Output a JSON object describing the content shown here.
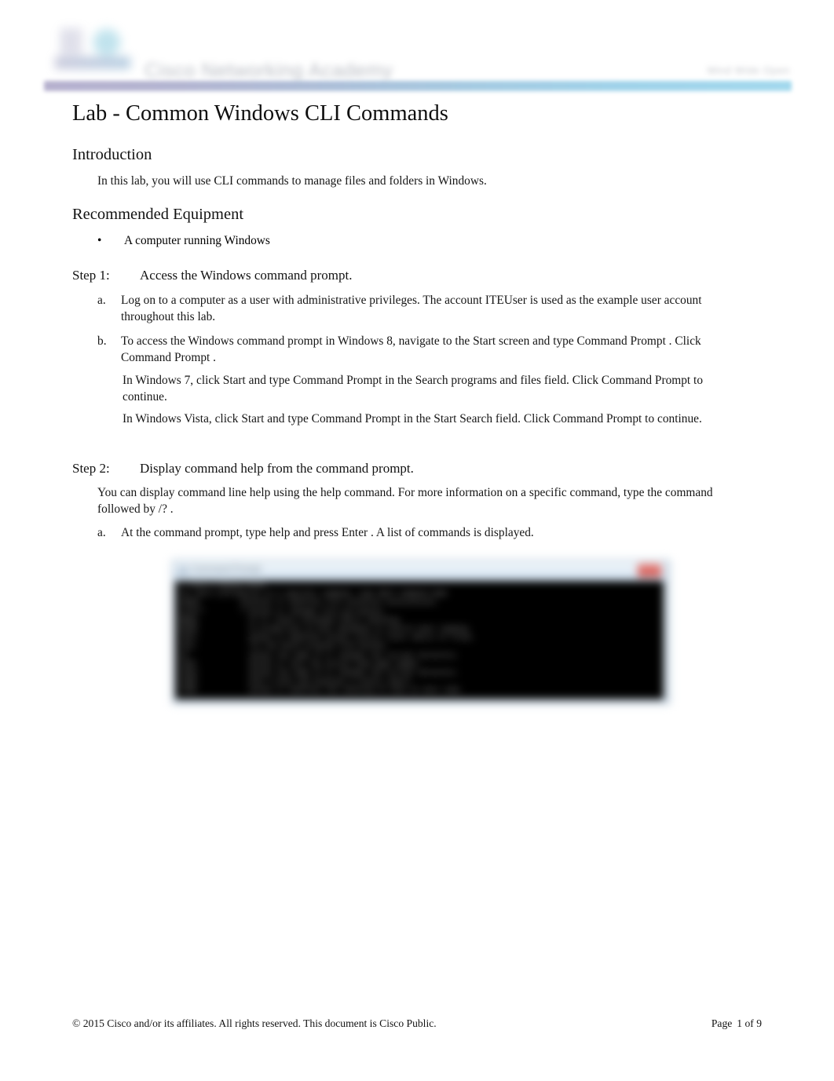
{
  "header": {
    "logo_alt": "cisco-networking-academy-logo",
    "brand_title": "Cisco Networking Academy",
    "tagline": "Mind Wide Open",
    "rule_color_left": "#a9a3c6",
    "rule_color_right": "#93d2ea"
  },
  "document": {
    "title": "Lab - Common Windows CLI Commands"
  },
  "sections": {
    "introduction": {
      "heading": "Introduction",
      "body": "In this lab, you will use CLI commands to manage files and folders in Windows."
    },
    "equipment": {
      "heading": "Recommended Equipment",
      "bullet_glyph": "•",
      "items": [
        "A computer running Windows"
      ]
    },
    "step1": {
      "label": "Step 1:",
      "title": "Access the Windows command prompt.",
      "items": [
        {
          "marker": "a.",
          "text": "Log on to a computer as a user with administrative privileges. The account         ITEUser  is used as the example user account throughout this lab."
        },
        {
          "marker": "b.",
          "text": "To access the Windows command prompt in Windows 8, navigate to the         Start   screen and type Command Prompt     . Click Command Prompt      ."
        }
      ],
      "paragraphs": [
        "In Windows 7, click   Start   and type   Command Prompt      in the  Search programs and files        field. Click Command Prompt      to continue.",
        "In Windows Vista, click   Start   and type   Command Prompt      in the  Start Search      field. Click  Command Prompt   to continue."
      ]
    },
    "step2": {
      "label": "Step 2:",
      "title": "Display command help from the command prompt.",
      "intro": "You can display command line help using the        help   command. For more information on a specific command, type the command followed by      /? .",
      "items": [
        {
          "marker": "a.",
          "text": "At the command prompt, type     help   and press   Enter  . A list of commands is displayed."
        }
      ]
    }
  },
  "screenshot": {
    "name": "command-prompt-help-output",
    "window_title": "Command Prompt",
    "close_label": "x",
    "console_lines": [
      "C:\\Users\\ITEUser>help",
      "For more information on a specific command, type HELP command-name",
      "ASSOC          Displays or modifies file extension associations.",
      "ATTRIB         Displays or changes file attributes.",
      "BREAK          Sets or clears extended CTRL+C checking.",
      "BCDEDIT        Sets properties in boot database to control boot loading.",
      "CACLS          Displays or modifies access control lists (ACLs) of files.",
      "CALL           Calls one batch program from another.",
      "CD             Displays the name of or changes the current directory.",
      "CHCP           Displays or sets the active code page number.",
      "CHDIR          Displays the name of or changes the current directory.",
      "CHKDSK         Checks a disk and displays a status report.",
      "CHKNTFS        Displays or modifies the checking of disk at boot time."
    ]
  },
  "footer": {
    "copyright": "© 2015 Cisco and/or its affiliates. All rights reserved. This document is Cisco Public.",
    "page_label": "Page",
    "page_number": "1 of 9"
  }
}
